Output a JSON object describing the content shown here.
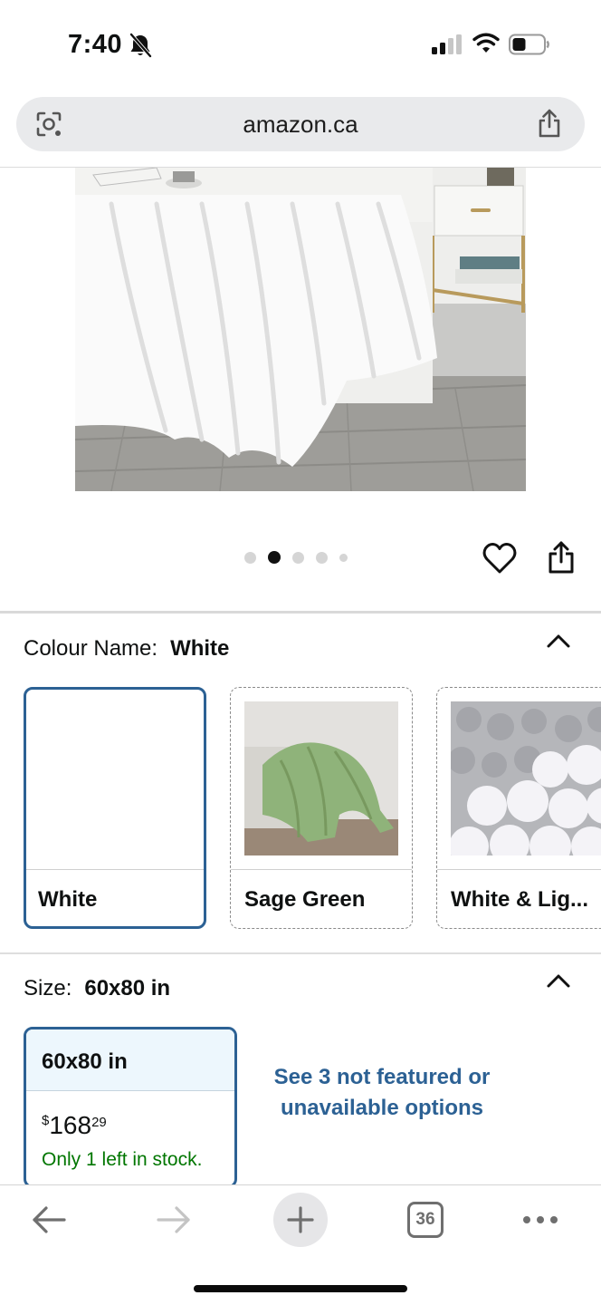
{
  "status_bar": {
    "time": "7:40",
    "icons": [
      "bell-slash-icon",
      "cellular-signal-icon",
      "wifi-icon",
      "battery-icon"
    ]
  },
  "browser": {
    "url": "amazon.ca",
    "icons": [
      "lens-icon",
      "share-icon"
    ]
  },
  "carousel": {
    "total_images": 5,
    "active_index": 2
  },
  "colour": {
    "label": "Colour Name:",
    "selected": "White",
    "options": [
      {
        "label": "White",
        "selected": true
      },
      {
        "label": "Sage Green",
        "selected": false
      },
      {
        "label": "White & Lig...",
        "selected": false
      }
    ]
  },
  "size": {
    "label": "Size:",
    "selected": "60x80 in",
    "card": {
      "title": "60x80 in",
      "currency": "$",
      "price_whole": "168",
      "price_cents": "29",
      "stock": "Only 1 left in stock."
    },
    "more_options": "See 3 not featured or unavailable options"
  },
  "toolbar": {
    "tab_count": "36",
    "icons": [
      "back-arrow-icon",
      "forward-arrow-icon",
      "plus-icon",
      "tabs-icon",
      "more-icon"
    ]
  },
  "colors": {
    "accent_blue": "#2c6194",
    "stock_green": "#007600",
    "size_card_header": "#edf7fd"
  }
}
